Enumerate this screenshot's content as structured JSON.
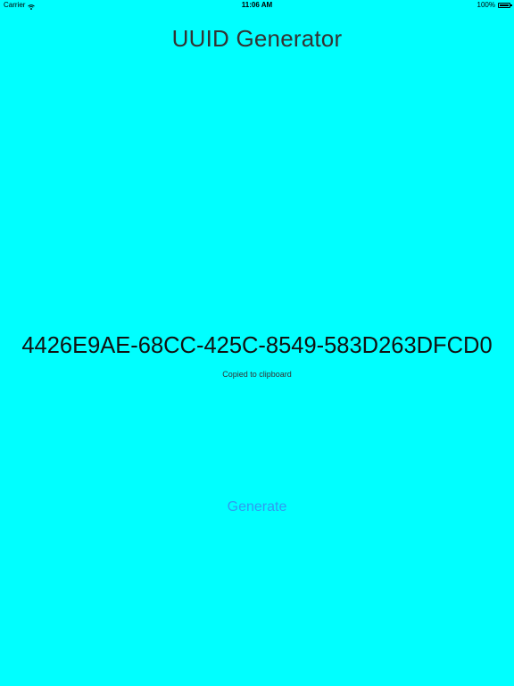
{
  "status_bar": {
    "carrier": "Carrier",
    "time": "11:06 AM",
    "battery_percent": "100%",
    "battery_level": 1.0,
    "icons": [
      "wifi-icon",
      "battery-icon"
    ]
  },
  "app": {
    "title": "UUID Generator",
    "uuid": "4426E9AE-68CC-425C-8549-583D263DFCD0",
    "status": "Copied to clipboard",
    "generate_label": "Generate"
  },
  "colors": {
    "background": "#00ffff",
    "accent": "#2f9bf0"
  }
}
